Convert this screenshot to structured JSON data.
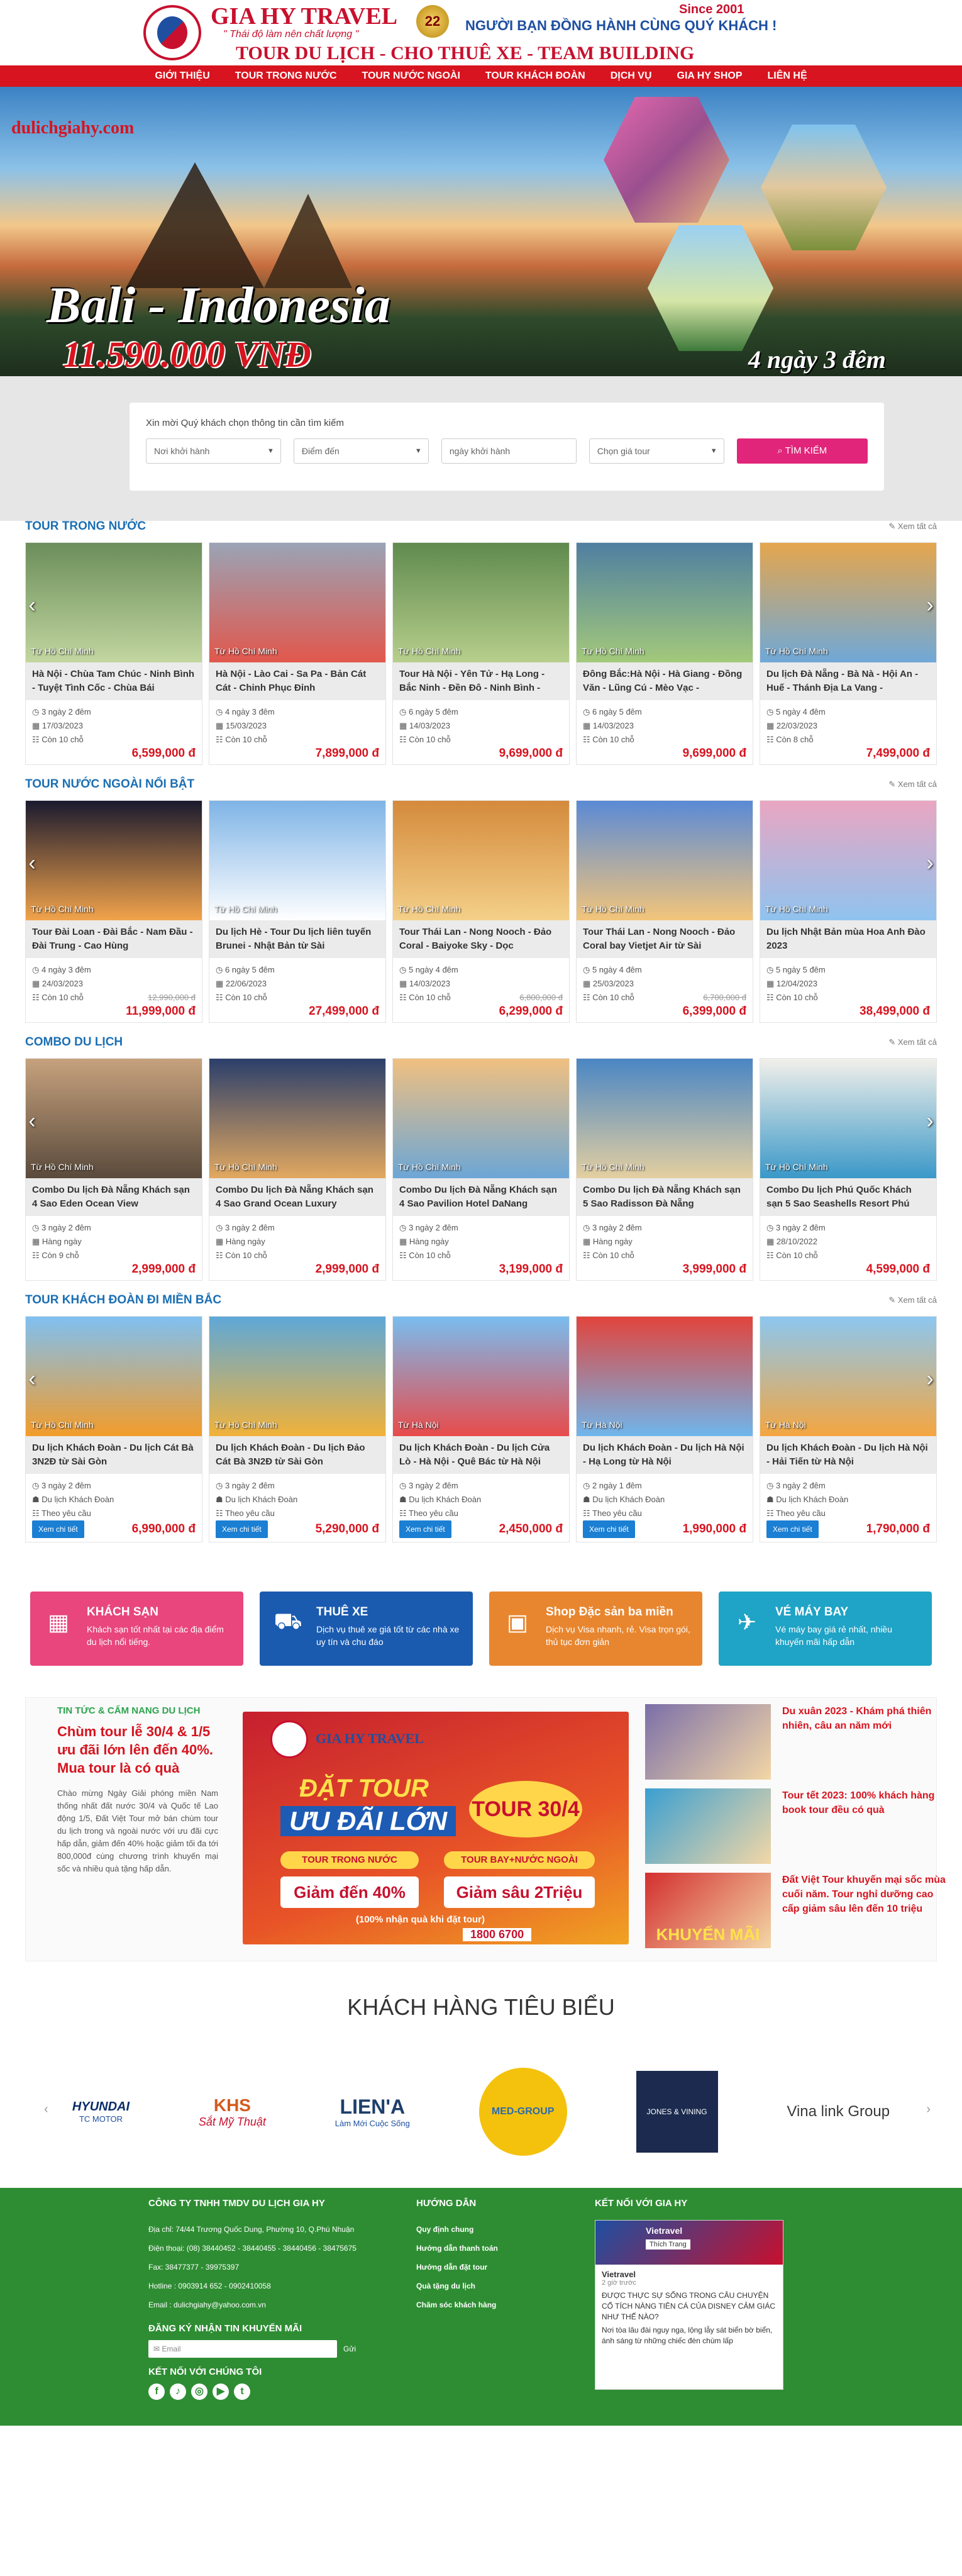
{
  "header": {
    "brand_name": "GIA HY TRAVEL",
    "brand_tagline": "\" Thái độ làm nên chất lượng \"",
    "brand_services": "TOUR DU LỊCH - CHO THUÊ XE - TEAM BUILDING",
    "badge": "22",
    "since": "Since 2001",
    "slogan": "NGƯỜI BẠN ĐỒNG HÀNH CÙNG QUÝ KHÁCH !"
  },
  "nav": [
    "GIỚI THIỆU",
    "TOUR TRONG NƯỚC",
    "TOUR NƯỚC NGOÀI",
    "TOUR KHÁCH ĐOÀN",
    "DỊCH VỤ",
    "GIA HY SHOP",
    "LIÊN HỆ"
  ],
  "banner": {
    "site": "dulichgiahy.com",
    "title": "Bali - Indonesia",
    "price": "11.590.000 VNĐ",
    "duration": "4 ngày 3 đêm"
  },
  "search": {
    "title": "Xin mời Quý khách chọn thông tin cần tìm kiếm",
    "from": "Nơi khởi hành",
    "to": "Điểm đến",
    "date": "ngày khởi hành",
    "price": "Chọn giá tour",
    "button": "TÌM KIẾM"
  },
  "more": "Xem tất cả",
  "sections": [
    {
      "title": "TOUR TRONG NƯỚC",
      "cards": [
        {
          "loc": "Từ Hồ Chí Minh",
          "name": "Hà Nội - Chùa Tam Chúc - Ninh Bình - Tuyệt Tình Cốc - Chùa Bái",
          "dur": "3 ngày 2 đêm",
          "date": "17/03/2023",
          "seats": "Còn 10 chỗ",
          "old": "",
          "price": "6,599,000 đ"
        },
        {
          "loc": "Từ Hồ Chí Minh",
          "name": "Hà Nội - Lào Cai - Sa Pa - Bản Cát Cát - Chinh Phục Đỉnh",
          "dur": "4 ngày 3 đêm",
          "date": "15/03/2023",
          "seats": "Còn 10 chỗ",
          "old": "",
          "price": "7,899,000 đ"
        },
        {
          "loc": "Từ Hồ Chí Minh",
          "name": "Tour Hà Nội - Yên Tử - Hạ Long - Bắc Ninh - Đền Đô - Ninh Bình -",
          "dur": "6 ngày 5 đêm",
          "date": "14/03/2023",
          "seats": "Còn 10 chỗ",
          "old": "",
          "price": "9,699,000 đ"
        },
        {
          "loc": "Từ Hồ Chí Minh",
          "name": "Đông Bắc:Hà Nội - Hà Giang - Đồng Văn - Lũng Cú - Mèo Vạc -",
          "dur": "6 ngày 5 đêm",
          "date": "14/03/2023",
          "seats": "Còn 10 chỗ",
          "old": "",
          "price": "9,699,000 đ"
        },
        {
          "loc": "Từ Hồ Chí Minh",
          "name": "Du lịch Đà Nẵng - Bà Nà - Hội An - Huế - Thánh Địa La Vang -",
          "dur": "5 ngày 4 đêm",
          "date": "22/03/2023",
          "seats": "Còn 8 chỗ",
          "old": "",
          "price": "7,499,000 đ"
        }
      ]
    },
    {
      "title": "TOUR NƯỚC NGOÀI NỔI BẬT",
      "cards": [
        {
          "loc": "Từ Hồ Chí Minh",
          "name": "Tour Đài Loan - Đài Bắc - Nam Đầu - Đài Trung - Cao Hùng",
          "dur": "4 ngày 3 đêm",
          "date": "24/03/2023",
          "seats": "Còn 10 chỗ",
          "old": "12,990,000 đ",
          "price": "11,999,000 đ"
        },
        {
          "loc": "Từ Hồ Chí Minh",
          "name": "Du lịch Hè - Tour Du lịch liên tuyến Brunei - Nhật Bản từ Sài",
          "dur": "6 ngày 5 đêm",
          "date": "22/06/2023",
          "seats": "Còn 10 chỗ",
          "old": "",
          "price": "27,499,000 đ"
        },
        {
          "loc": "Từ Hồ Chí Minh",
          "name": "Tour Thái Lan - Nong Nooch - Đảo Coral - Baiyoke Sky - Dọc",
          "dur": "5 ngày 4 đêm",
          "date": "14/03/2023",
          "seats": "Còn 10 chỗ",
          "old": "6,800,000 đ",
          "price": "6,299,000 đ"
        },
        {
          "loc": "Từ Hồ Chí Minh",
          "name": "Tour Thái Lan - Nong Nooch - Đảo Coral bay Vietjet Air từ Sài",
          "dur": "5 ngày 4 đêm",
          "date": "25/03/2023",
          "seats": "Còn 10 chỗ",
          "old": "6,700,000 đ",
          "price": "6,399,000 đ"
        },
        {
          "loc": "Từ Hồ Chí Minh",
          "name": "Du lịch Nhật Bản mùa Hoa Anh Đào 2023",
          "dur": "5 ngày 5 đêm",
          "date": "12/04/2023",
          "seats": "Còn 10 chỗ",
          "old": "",
          "price": "38,499,000 đ"
        }
      ]
    },
    {
      "title": "COMBO DU LỊCH",
      "cards": [
        {
          "loc": "Từ Hồ Chí Minh",
          "name": "Combo Du lịch Đà Nẵng Khách sạn 4 Sao Eden Ocean View",
          "dur": "3 ngày 2 đêm",
          "date": "Hàng ngày",
          "seats": "Còn 9 chỗ",
          "old": "",
          "price": "2,999,000 đ"
        },
        {
          "loc": "Từ Hồ Chí Minh",
          "name": "Combo Du lịch Đà Nẵng Khách sạn 4 Sao Grand Ocean Luxury",
          "dur": "3 ngày 2 đêm",
          "date": "Hàng ngày",
          "seats": "Còn 10 chỗ",
          "old": "",
          "price": "2,999,000 đ"
        },
        {
          "loc": "Từ Hồ Chí Minh",
          "name": "Combo Du lịch Đà Nẵng Khách sạn 4 Sao Pavilion Hotel DaNang",
          "dur": "3 ngày 2 đêm",
          "date": "Hàng ngày",
          "seats": "Còn 10 chỗ",
          "old": "",
          "price": "3,199,000 đ"
        },
        {
          "loc": "Từ Hồ Chí Minh",
          "name": "Combo Du lịch Đà Nẵng Khách sạn 5 Sao Radisson Đà Nẵng",
          "dur": "3 ngày 2 đêm",
          "date": "Hàng ngày",
          "seats": "Còn 10 chỗ",
          "old": "",
          "price": "3,999,000 đ"
        },
        {
          "loc": "Từ Hồ Chí Minh",
          "name": "Combo Du lịch Phú Quốc Khách sạn 5 Sao Seashells Resort Phú",
          "dur": "3 ngày 2 đêm",
          "date": "28/10/2022",
          "seats": "Còn 10 chỗ",
          "old": "",
          "price": "4,599,000 đ"
        }
      ]
    },
    {
      "title": "TOUR KHÁCH ĐOÀN ĐI MIỀN BẮC",
      "cards": [
        {
          "loc": "Từ Hồ Chí Minh",
          "name": "Du lịch Khách Đoàn - Du lịch Cát Bà 3N2Đ từ Sài Gòn",
          "dur": "3 ngày 2 đêm",
          "date": "Du lịch Khách Đoàn",
          "seats": "Theo yêu cầu",
          "old": "",
          "price": "6,990,000 đ"
        },
        {
          "loc": "Từ Hồ Chí Minh",
          "name": "Du lịch Khách Đoàn - Du lịch Đảo Cát Bà 3N2Đ từ Sài Gòn",
          "dur": "3 ngày 2 đêm",
          "date": "Du lịch Khách Đoàn",
          "seats": "Theo yêu cầu",
          "old": "",
          "price": "5,290,000 đ"
        },
        {
          "loc": "Từ Hà Nội",
          "name": "Du lịch Khách Đoàn - Du lịch Cửa Lò - Hà Nội - Quê Bác từ Hà Nội",
          "dur": "3 ngày 2 đêm",
          "date": "Du lịch Khách Đoàn",
          "seats": "Theo yêu cầu",
          "old": "",
          "price": "2,450,000 đ"
        },
        {
          "loc": "Từ Hà Nội",
          "name": "Du lịch Khách Đoàn - Du lịch Hà Nội - Hạ Long từ Hà Nội",
          "dur": "2 ngày 1 đêm",
          "date": "Du lịch Khách Đoàn",
          "seats": "Theo yêu cầu",
          "old": "",
          "price": "1,990,000 đ"
        },
        {
          "loc": "Từ Hà Nội",
          "name": "Du lịch Khách Đoàn - Du lịch Hà Nội - Hải Tiến từ Hà Nội",
          "dur": "3 ngày 2 đêm",
          "date": "Du lịch Khách Đoàn",
          "seats": "Theo yêu cầu",
          "old": "",
          "price": "1,790,000 đ"
        }
      ]
    }
  ],
  "detail_button": "Xem chi tiết",
  "services": [
    {
      "title": "KHÁCH SẠN",
      "desc": "Khách sạn tốt nhất tại các địa điểm du lịch nổi tiếng.",
      "color": "#e8467c",
      "icon": "hotel-icon"
    },
    {
      "title": "THUÊ XE",
      "desc": "Dịch vụ thuê xe giá tốt từ các nhà xe uy tín và chu đáo",
      "color": "#1a5bb0",
      "icon": "car-icon"
    },
    {
      "title": "Shop Đặc sản ba miền",
      "desc": "Dịch vụ Visa nhanh, rẻ. Visa trọn gói, thủ tục đơn giản",
      "color": "#e8862f",
      "icon": "shop-icon"
    },
    {
      "title": "VÉ MÁY BAY",
      "desc": "Vé máy bay giá rẻ nhất, nhiều khuyến mãi hấp dẫn",
      "color": "#1fa3c6",
      "icon": "plane-icon"
    }
  ],
  "news": {
    "category": "TIN TỨC & CẨM NANG DU LỊCH",
    "headline": "Chùm tour lễ 30/4 & 1/5 ưu đãi lớn lên đến 40%. Mua tour là có quà",
    "body": "Chào mừng Ngày Giải phóng miền Nam thống nhất đất nước 30/4 và Quốc tế Lao động 1/5, Đất Việt Tour mở bán chùm tour du lịch trong và ngoài nước với ưu đãi cực hấp dẫn, giảm đến 40% hoặc giảm tối đa tới 800,000đ cùng chương trình khuyến mại sốc và nhiều quà tặng hấp dẫn.",
    "promo": {
      "brand": "GIA HY TRAVEL",
      "l1": "ĐẶT TOUR",
      "l2": "ƯU ĐÃI LỚN",
      "tag": "TOUR 30/4",
      "c1": "TOUR TRONG NƯỚC",
      "c2": "TOUR BAY+NƯỚC NGOÀI",
      "d1": "Giảm đến 40%",
      "d2": "Giảm sâu 2Triệu",
      "note": "(100% nhận quà khi đặt tour)",
      "hotline": "1800 6700"
    },
    "items": [
      {
        "title": "Du xuân 2023 - Khám phá thiên nhiên, câu an năm mới",
        "color": "#7b6fa8"
      },
      {
        "title": "Tour tết 2023: 100% khách hàng book tour đều có quà",
        "color": "#3a9fd1"
      },
      {
        "title": "Đất Việt Tour khuyến mại sốc mùa cuối năm. Tour nghỉ dưỡng cao cấp giảm sâu lên đến 10 triệu",
        "color": "#d32f2f",
        "thumb_text": "KHUYẾN MÃI"
      }
    ]
  },
  "customers": {
    "title": "KHÁCH HÀNG TIÊU BIỂU",
    "logos": [
      {
        "name": "HYUNDAI",
        "sub": "TC MOTOR"
      },
      {
        "name": "KHS",
        "sub": "Sắt Mỹ Thuật"
      },
      {
        "name": "LIEN'A",
        "sub": "Làm Mới Cuộc Sống"
      },
      {
        "name": "MED-GROUP",
        "sub": ""
      },
      {
        "name": "JONES & VINING",
        "sub": ""
      },
      {
        "name": "Vina link Group",
        "sub": ""
      }
    ]
  },
  "footer": {
    "company": "CÔNG TY TNHH TMDV DU LỊCH GIA HY",
    "address": "Địa chỉ: 74/44 Trương Quốc Dung, Phường 10, Q.Phú Nhuận",
    "phone": "Điện thoại: (08) 38440452 - 38440455 - 38440456 - 38475675",
    "fax": "Fax: 38477377 - 39975397",
    "hotline": "Hotline : 0903914 652 - 0902410058",
    "email": "Email : dulichgiahy@yahoo.com.vn",
    "subscribe": "ĐĂNG KÝ NHẬN TIN KHUYẾN MÃI",
    "email_placeholder": "Email",
    "send": "Gửi",
    "connect": "KẾT NỐI VỚI CHÚNG TÔI",
    "guide_title": "HƯỚNG DẪN",
    "guide": [
      "Quy định chung",
      "Hướng dẫn thanh toán",
      "Hướng dẫn đặt tour",
      "Quà tặng du lịch",
      "Chăm sóc khách hàng"
    ],
    "fb_title": "KẾT NỐI VỚI GIA HY",
    "fb": {
      "page": "Vietravel",
      "like": "Thích Trang",
      "time": "2 giờ trước",
      "post": "ĐƯỢC THỰC SỰ SỐNG TRONG CÂU CHUYỆN CỔ TÍCH NÀNG TIÊN CÁ CỦA DISNEY CẢM GIÁC NHƯ THẾ NÀO?",
      "post2": "Nơi tòa lâu đài nguy nga, lộng lẫy sát biển bờ biển, ánh sáng từ những chiếc đèn chùm lấp"
    }
  }
}
